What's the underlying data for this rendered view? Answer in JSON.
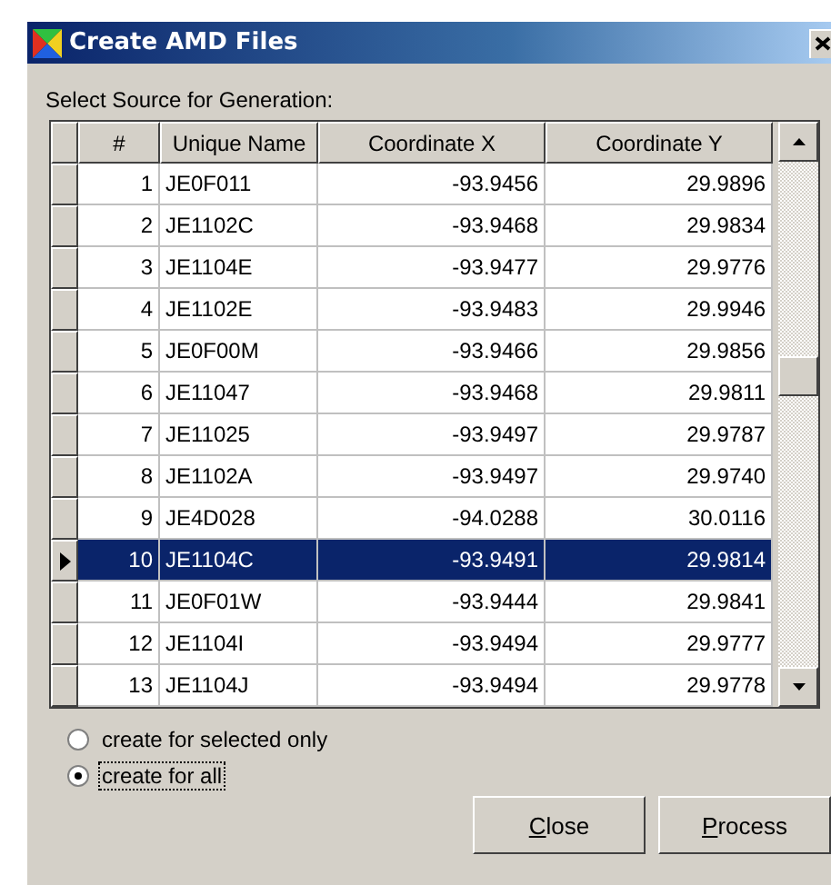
{
  "window": {
    "title": "Create AMD Files"
  },
  "source_label": "Select Source for Generation:",
  "table": {
    "columns": [
      "#",
      "Unique Name",
      "Coordinate X",
      "Coordinate Y"
    ],
    "rows": [
      {
        "cells": [
          "1",
          "JE0F011",
          "-93.9456",
          "29.9896"
        ],
        "selected": false
      },
      {
        "cells": [
          "2",
          "JE1102C",
          "-93.9468",
          "29.9834"
        ],
        "selected": false
      },
      {
        "cells": [
          "3",
          "JE1104E",
          "-93.9477",
          "29.9776"
        ],
        "selected": false
      },
      {
        "cells": [
          "4",
          "JE1102E",
          "-93.9483",
          "29.9946"
        ],
        "selected": false
      },
      {
        "cells": [
          "5",
          "JE0F00M",
          "-93.9466",
          "29.9856"
        ],
        "selected": false
      },
      {
        "cells": [
          "6",
          "JE11047",
          "-93.9468",
          "29.9811"
        ],
        "selected": false
      },
      {
        "cells": [
          "7",
          "JE11025",
          "-93.9497",
          "29.9787"
        ],
        "selected": false
      },
      {
        "cells": [
          "8",
          "JE1102A",
          "-93.9497",
          "29.9740"
        ],
        "selected": false
      },
      {
        "cells": [
          "9",
          "JE4D028",
          "-94.0288",
          "30.0116"
        ],
        "selected": false
      },
      {
        "cells": [
          "10",
          "JE1104C",
          "-93.9491",
          "29.9814"
        ],
        "selected": true
      },
      {
        "cells": [
          "11",
          "JE0F01W",
          "-93.9444",
          "29.9841"
        ],
        "selected": false
      },
      {
        "cells": [
          "12",
          "JE1104I",
          "-93.9494",
          "29.9777"
        ],
        "selected": false
      },
      {
        "cells": [
          "13",
          "JE1104J",
          "-93.9494",
          "29.9778"
        ],
        "selected": false
      }
    ]
  },
  "options": [
    {
      "label": "create for selected only",
      "selected": false
    },
    {
      "label": "create for all",
      "selected": true
    }
  ],
  "buttons": [
    {
      "label": "Close"
    },
    {
      "label": "Process"
    }
  ]
}
